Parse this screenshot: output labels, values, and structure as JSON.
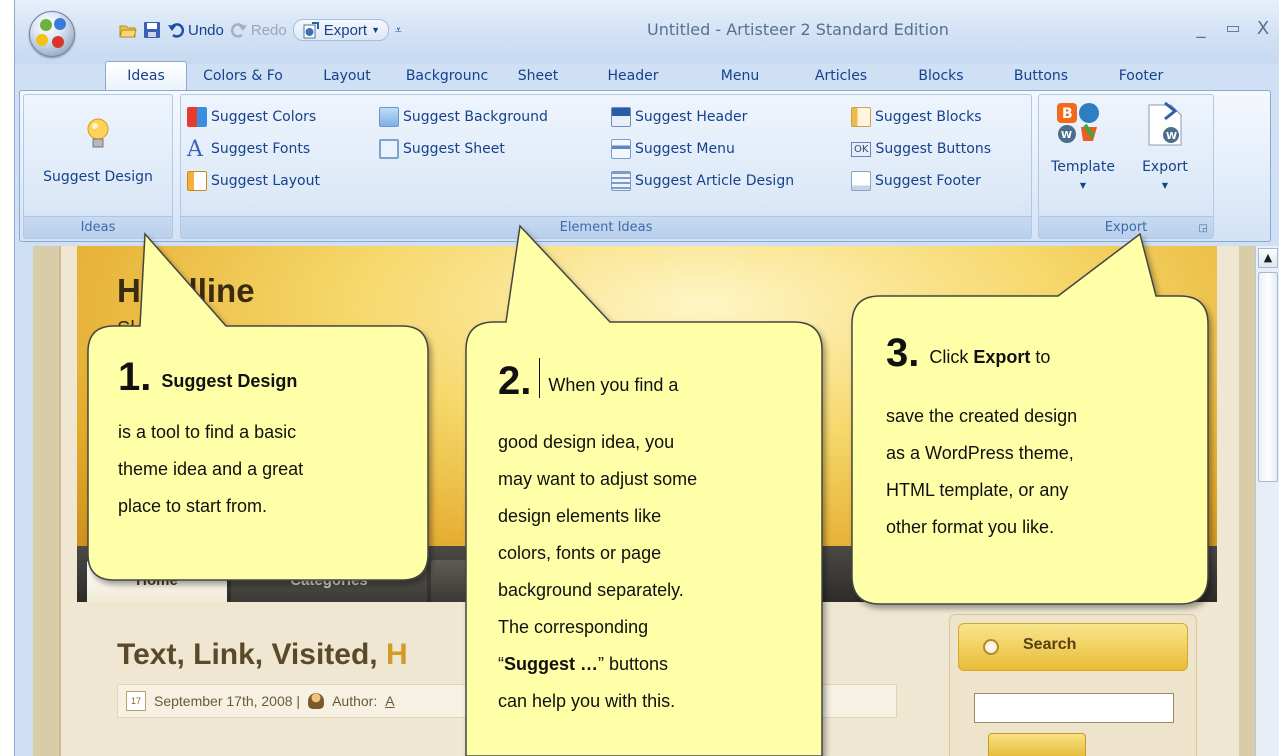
{
  "window": {
    "title": "Untitled - Artisteer 2 Standard Edition",
    "controls": {
      "minimize": "_",
      "maximize": "▭",
      "close": "X"
    }
  },
  "quick_access": {
    "undo_label": "Undo",
    "redo_label": "Redo",
    "export_label": "Export",
    "customize_glyph": "⩡"
  },
  "tabs": [
    {
      "label": "Ideas",
      "active": true
    },
    {
      "label": "Colors & Fo"
    },
    {
      "label": "Layout"
    },
    {
      "label": "Backgrounc"
    },
    {
      "label": "Sheet"
    },
    {
      "label": "Header"
    },
    {
      "label": "Menu"
    },
    {
      "label": "Articles"
    },
    {
      "label": "Blocks"
    },
    {
      "label": "Buttons"
    },
    {
      "label": "Footer"
    }
  ],
  "ribbon": {
    "ideas_group": {
      "label": "Ideas",
      "suggest_design": "Suggest Design"
    },
    "element_ideas_group": {
      "label": "Element Ideas",
      "items": {
        "suggest_colors": "Suggest Colors",
        "suggest_fonts": "Suggest Fonts",
        "suggest_layout": "Suggest Layout",
        "suggest_background": "Suggest Background",
        "suggest_sheet": "Suggest Sheet",
        "suggest_header": "Suggest Header",
        "suggest_menu": "Suggest Menu",
        "suggest_article_design": "Suggest Article Design",
        "suggest_blocks": "Suggest Blocks",
        "suggest_buttons": "Suggest Buttons",
        "suggest_footer": "Suggest Footer"
      },
      "ok_badge": "OK"
    },
    "export_group": {
      "label": "Export",
      "template": "Template",
      "export": "Export"
    }
  },
  "preview": {
    "headline": "Headline",
    "slogan": "Sl",
    "menu": {
      "home": "Home",
      "categories": "Categories"
    },
    "post_title_main": "Text, Link, Visited, ",
    "post_title_highlight": "H",
    "meta_date": "September 17th, 2008 |",
    "meta_author_label": "Author:",
    "meta_author_link": "A",
    "calendar_day": "17",
    "search_title": "Search"
  },
  "callouts": {
    "one": {
      "number": "1.",
      "heading": "Suggest Design",
      "lines": [
        "is a tool to find a basic",
        "theme idea and a great",
        "place to start from."
      ]
    },
    "two": {
      "number": "2.",
      "intro": "When you find a",
      "lines": [
        "good design idea, you",
        "may want to adjust some",
        "design elements like",
        "colors, fonts or page",
        "background separately.",
        "The corresponding"
      ],
      "quote_open": "“",
      "quote_bold": "Suggest …",
      "quote_rest": "” buttons",
      "last_line": "can help you with this."
    },
    "three": {
      "number": "3.",
      "click": "Click ",
      "export_bold": "Export",
      "to": " to",
      "lines": [
        "save the created design",
        "as a WordPress theme,",
        "HTML template, or any",
        "other format you like."
      ]
    }
  },
  "colors": {
    "ribbon_text": "#15428b",
    "callout_fill": "#ffffa8",
    "header_gold": "#e3a92a"
  }
}
